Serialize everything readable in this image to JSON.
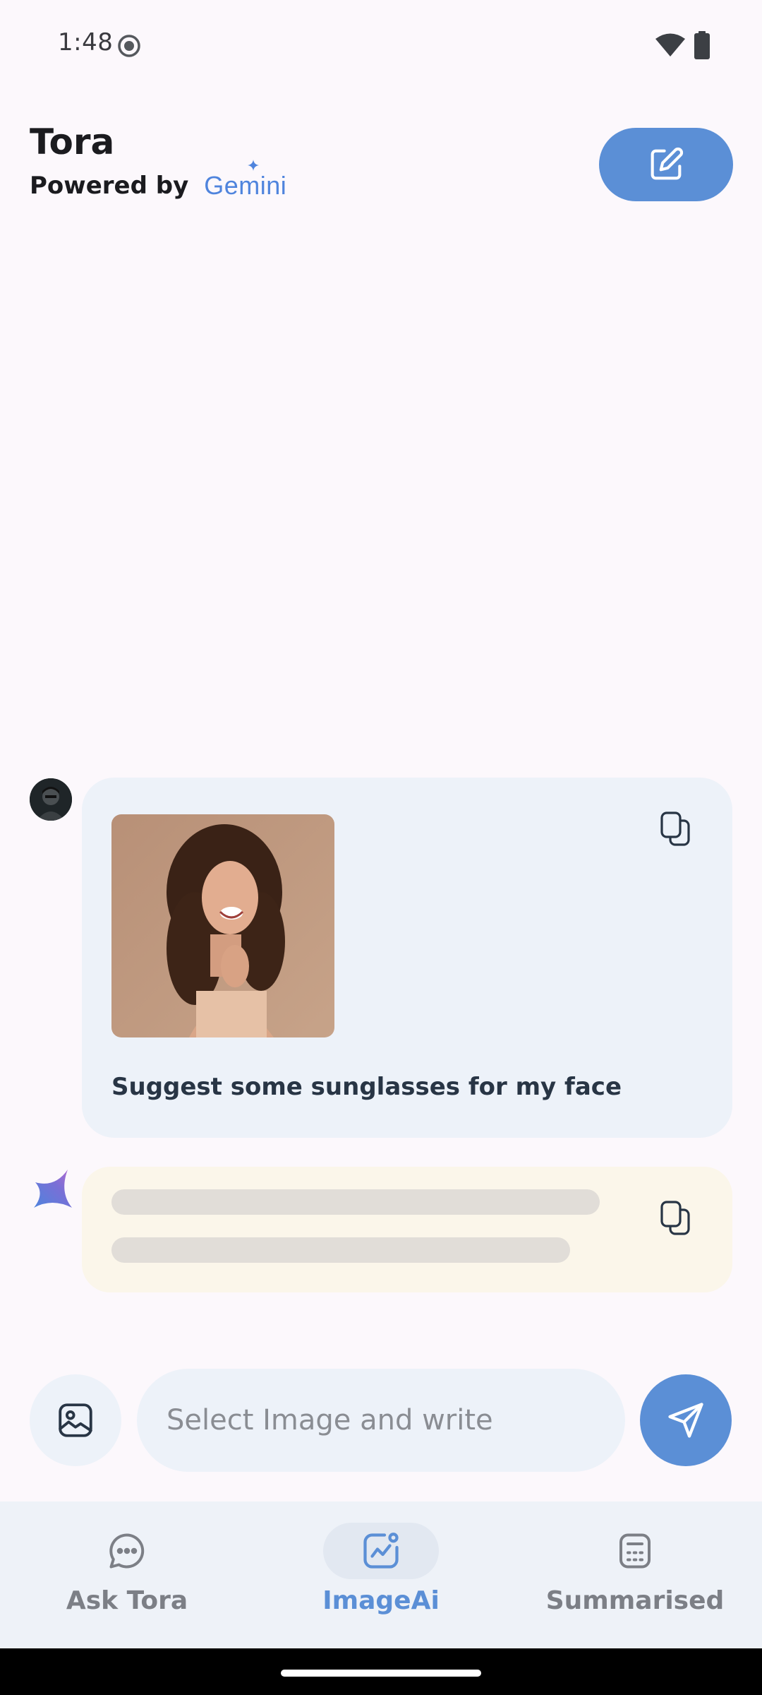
{
  "status_bar": {
    "time": "1:48",
    "icons": [
      "screen-record-icon",
      "wifi-icon",
      "battery-icon"
    ]
  },
  "header": {
    "title": "Tora",
    "powered_by": "Powered by",
    "brand": "Gemini",
    "edit_button_icon": "edit-icon"
  },
  "chat": {
    "user_message": {
      "avatar": "user-avatar",
      "image": "woman-portrait-photo",
      "text": "Suggest some sunglasses for my face",
      "copy_icon": "copy-icon"
    },
    "ai_response": {
      "state": "loading",
      "icon": "gemini-spark-icon",
      "copy_icon": "copy-icon"
    }
  },
  "composer": {
    "image_button_icon": "image-icon",
    "placeholder": "Select Image and write",
    "value": "",
    "send_icon": "send-icon"
  },
  "bottom_nav": {
    "items": [
      {
        "label": "Ask Tora",
        "icon": "chat-bubble-icon",
        "selected": false
      },
      {
        "label": "ImageAi",
        "icon": "image-analytics-icon",
        "selected": true
      },
      {
        "label": "Summarised",
        "icon": "document-icon",
        "selected": false
      }
    ]
  },
  "colors": {
    "accent": "#5b8fd6",
    "user_bubble": "#edf2f9",
    "ai_bubble": "#fbf6ea",
    "background": "#fcf8fc"
  }
}
